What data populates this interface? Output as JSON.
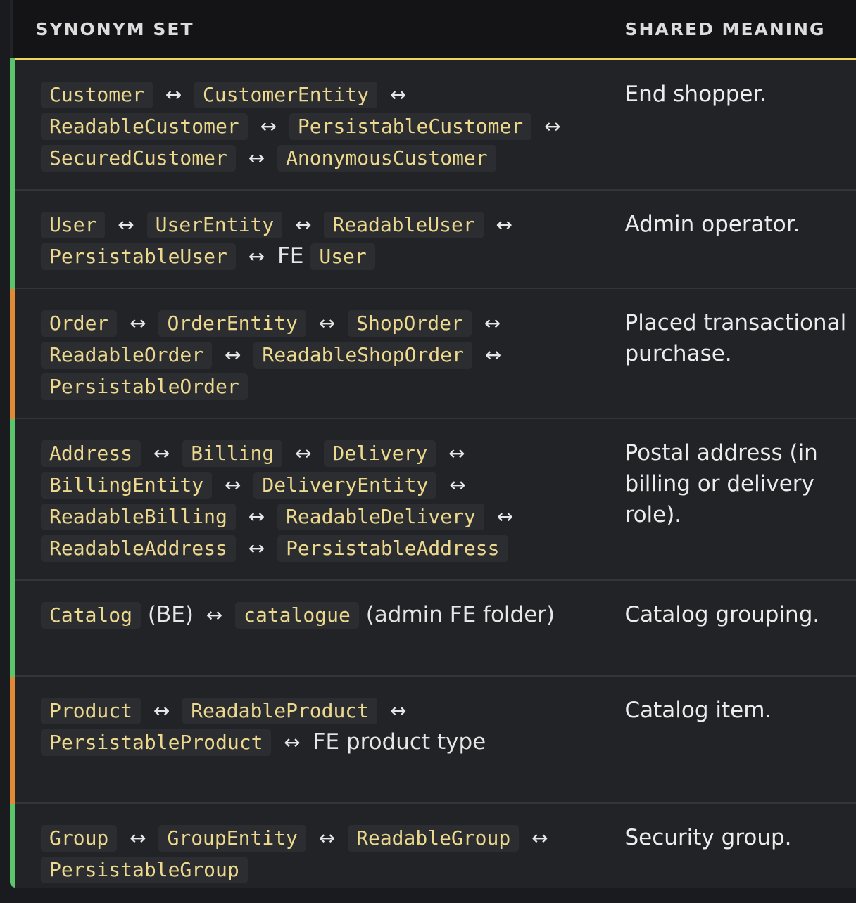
{
  "header": {
    "col_synonyms": "SYNONYM SET",
    "col_meaning": "SHARED MEANING"
  },
  "accent_colors": {
    "header_underline": "#f0d65a",
    "green": "#5cc46a",
    "orange": "#e08a38"
  },
  "arrow_glyph": "↔",
  "rows": [
    {
      "accent": "green",
      "meaning": "End shopper.",
      "parts": [
        {
          "t": "code",
          "v": "Customer"
        },
        {
          "t": "arrow"
        },
        {
          "t": "code",
          "v": "CustomerEntity"
        },
        {
          "t": "arrow"
        },
        {
          "t": "code",
          "v": "ReadableCustomer"
        },
        {
          "t": "arrow"
        },
        {
          "t": "code",
          "v": "PersistableCustomer"
        },
        {
          "t": "arrow"
        },
        {
          "t": "code",
          "v": "SecuredCustomer"
        },
        {
          "t": "arrow"
        },
        {
          "t": "code",
          "v": "AnonymousCustomer"
        }
      ]
    },
    {
      "accent": "green",
      "meaning": "Admin operator.",
      "parts": [
        {
          "t": "code",
          "v": "User"
        },
        {
          "t": "arrow"
        },
        {
          "t": "code",
          "v": "UserEntity"
        },
        {
          "t": "arrow"
        },
        {
          "t": "code",
          "v": "ReadableUser"
        },
        {
          "t": "arrow"
        },
        {
          "t": "code",
          "v": "PersistableUser"
        },
        {
          "t": "arrow"
        },
        {
          "t": "text",
          "v": "FE"
        },
        {
          "t": "code",
          "v": "User"
        }
      ]
    },
    {
      "accent": "orange",
      "meaning": "Placed transactional purchase.",
      "parts": [
        {
          "t": "code",
          "v": "Order"
        },
        {
          "t": "arrow"
        },
        {
          "t": "code",
          "v": "OrderEntity"
        },
        {
          "t": "arrow"
        },
        {
          "t": "code",
          "v": "ShopOrder"
        },
        {
          "t": "arrow"
        },
        {
          "t": "code",
          "v": "ReadableOrder"
        },
        {
          "t": "arrow"
        },
        {
          "t": "code",
          "v": "ReadableShopOrder"
        },
        {
          "t": "arrow"
        },
        {
          "t": "code",
          "v": "PersistableOrder"
        }
      ]
    },
    {
      "accent": "green",
      "meaning": "Postal address (in billing or delivery role).",
      "parts": [
        {
          "t": "code",
          "v": "Address"
        },
        {
          "t": "arrow"
        },
        {
          "t": "code",
          "v": "Billing"
        },
        {
          "t": "arrow"
        },
        {
          "t": "code",
          "v": "Delivery"
        },
        {
          "t": "arrow"
        },
        {
          "t": "code",
          "v": "BillingEntity"
        },
        {
          "t": "arrow"
        },
        {
          "t": "code",
          "v": "DeliveryEntity"
        },
        {
          "t": "arrow"
        },
        {
          "t": "code",
          "v": "ReadableBilling"
        },
        {
          "t": "arrow"
        },
        {
          "t": "code",
          "v": "ReadableDelivery"
        },
        {
          "t": "arrow"
        },
        {
          "t": "code",
          "v": "ReadableAddress"
        },
        {
          "t": "arrow"
        },
        {
          "t": "code",
          "v": "PersistableAddress"
        }
      ]
    },
    {
      "accent": "green",
      "meaning": "Catalog grouping.",
      "parts": [
        {
          "t": "code",
          "v": "Catalog"
        },
        {
          "t": "text",
          "v": "(BE)"
        },
        {
          "t": "arrow"
        },
        {
          "t": "code",
          "v": "catalogue"
        },
        {
          "t": "text",
          "v": "(admin FE folder)"
        }
      ]
    },
    {
      "accent": "orange",
      "meaning": "Catalog item.",
      "parts": [
        {
          "t": "code",
          "v": "Product"
        },
        {
          "t": "arrow"
        },
        {
          "t": "code",
          "v": "ReadableProduct"
        },
        {
          "t": "arrow"
        },
        {
          "t": "code",
          "v": "PersistableProduct"
        },
        {
          "t": "arrow"
        },
        {
          "t": "text",
          "v": "FE product type"
        }
      ]
    },
    {
      "accent": "green",
      "meaning": "Security group.",
      "parts": [
        {
          "t": "code",
          "v": "Group"
        },
        {
          "t": "arrow"
        },
        {
          "t": "code",
          "v": "GroupEntity"
        },
        {
          "t": "arrow"
        },
        {
          "t": "code",
          "v": "ReadableGroup"
        },
        {
          "t": "arrow"
        },
        {
          "t": "code",
          "v": "PersistableGroup"
        }
      ]
    }
  ]
}
